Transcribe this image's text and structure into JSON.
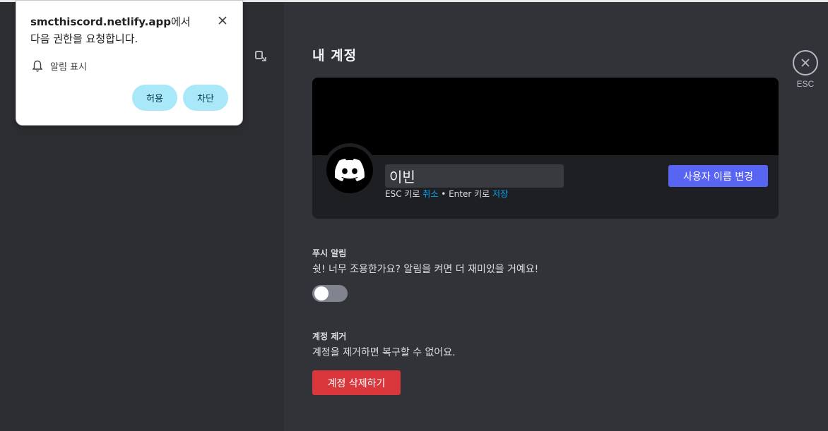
{
  "account": {
    "title": "내 계정",
    "close_label": "ESC",
    "username_value": "이빈",
    "hint": {
      "esc": "ESC 키로 ",
      "cancel": "취소",
      "sep": " • Enter 키로 ",
      "save": "저장"
    },
    "change_name_button": "사용자 이름 변경"
  },
  "push": {
    "label": "푸시 알림",
    "description": "쉿! 너무 조용한가요? 알림을 켜면 더 재미있을 거예요!",
    "enabled": false
  },
  "remove": {
    "label": "계정 제거",
    "description": "계정을 제거하면 복구할 수 없어요.",
    "button": "계정 삭제하기"
  },
  "permission_popup": {
    "origin": "smcthiscord.netlify.app",
    "request_text": "에서 다음 권한을 요청합니다.",
    "permission": "알림 표시",
    "allow": "허용",
    "block": "차단"
  },
  "colors": {
    "accent": "#5865f2",
    "danger": "#da373c",
    "link": "#00a8fc",
    "popup_button": "#a8e8f8"
  },
  "icons": {
    "close": "close-icon",
    "bell": "bell-icon",
    "avatar": "discord-logo-icon",
    "sidebar_tool": "screen-share-icon"
  }
}
